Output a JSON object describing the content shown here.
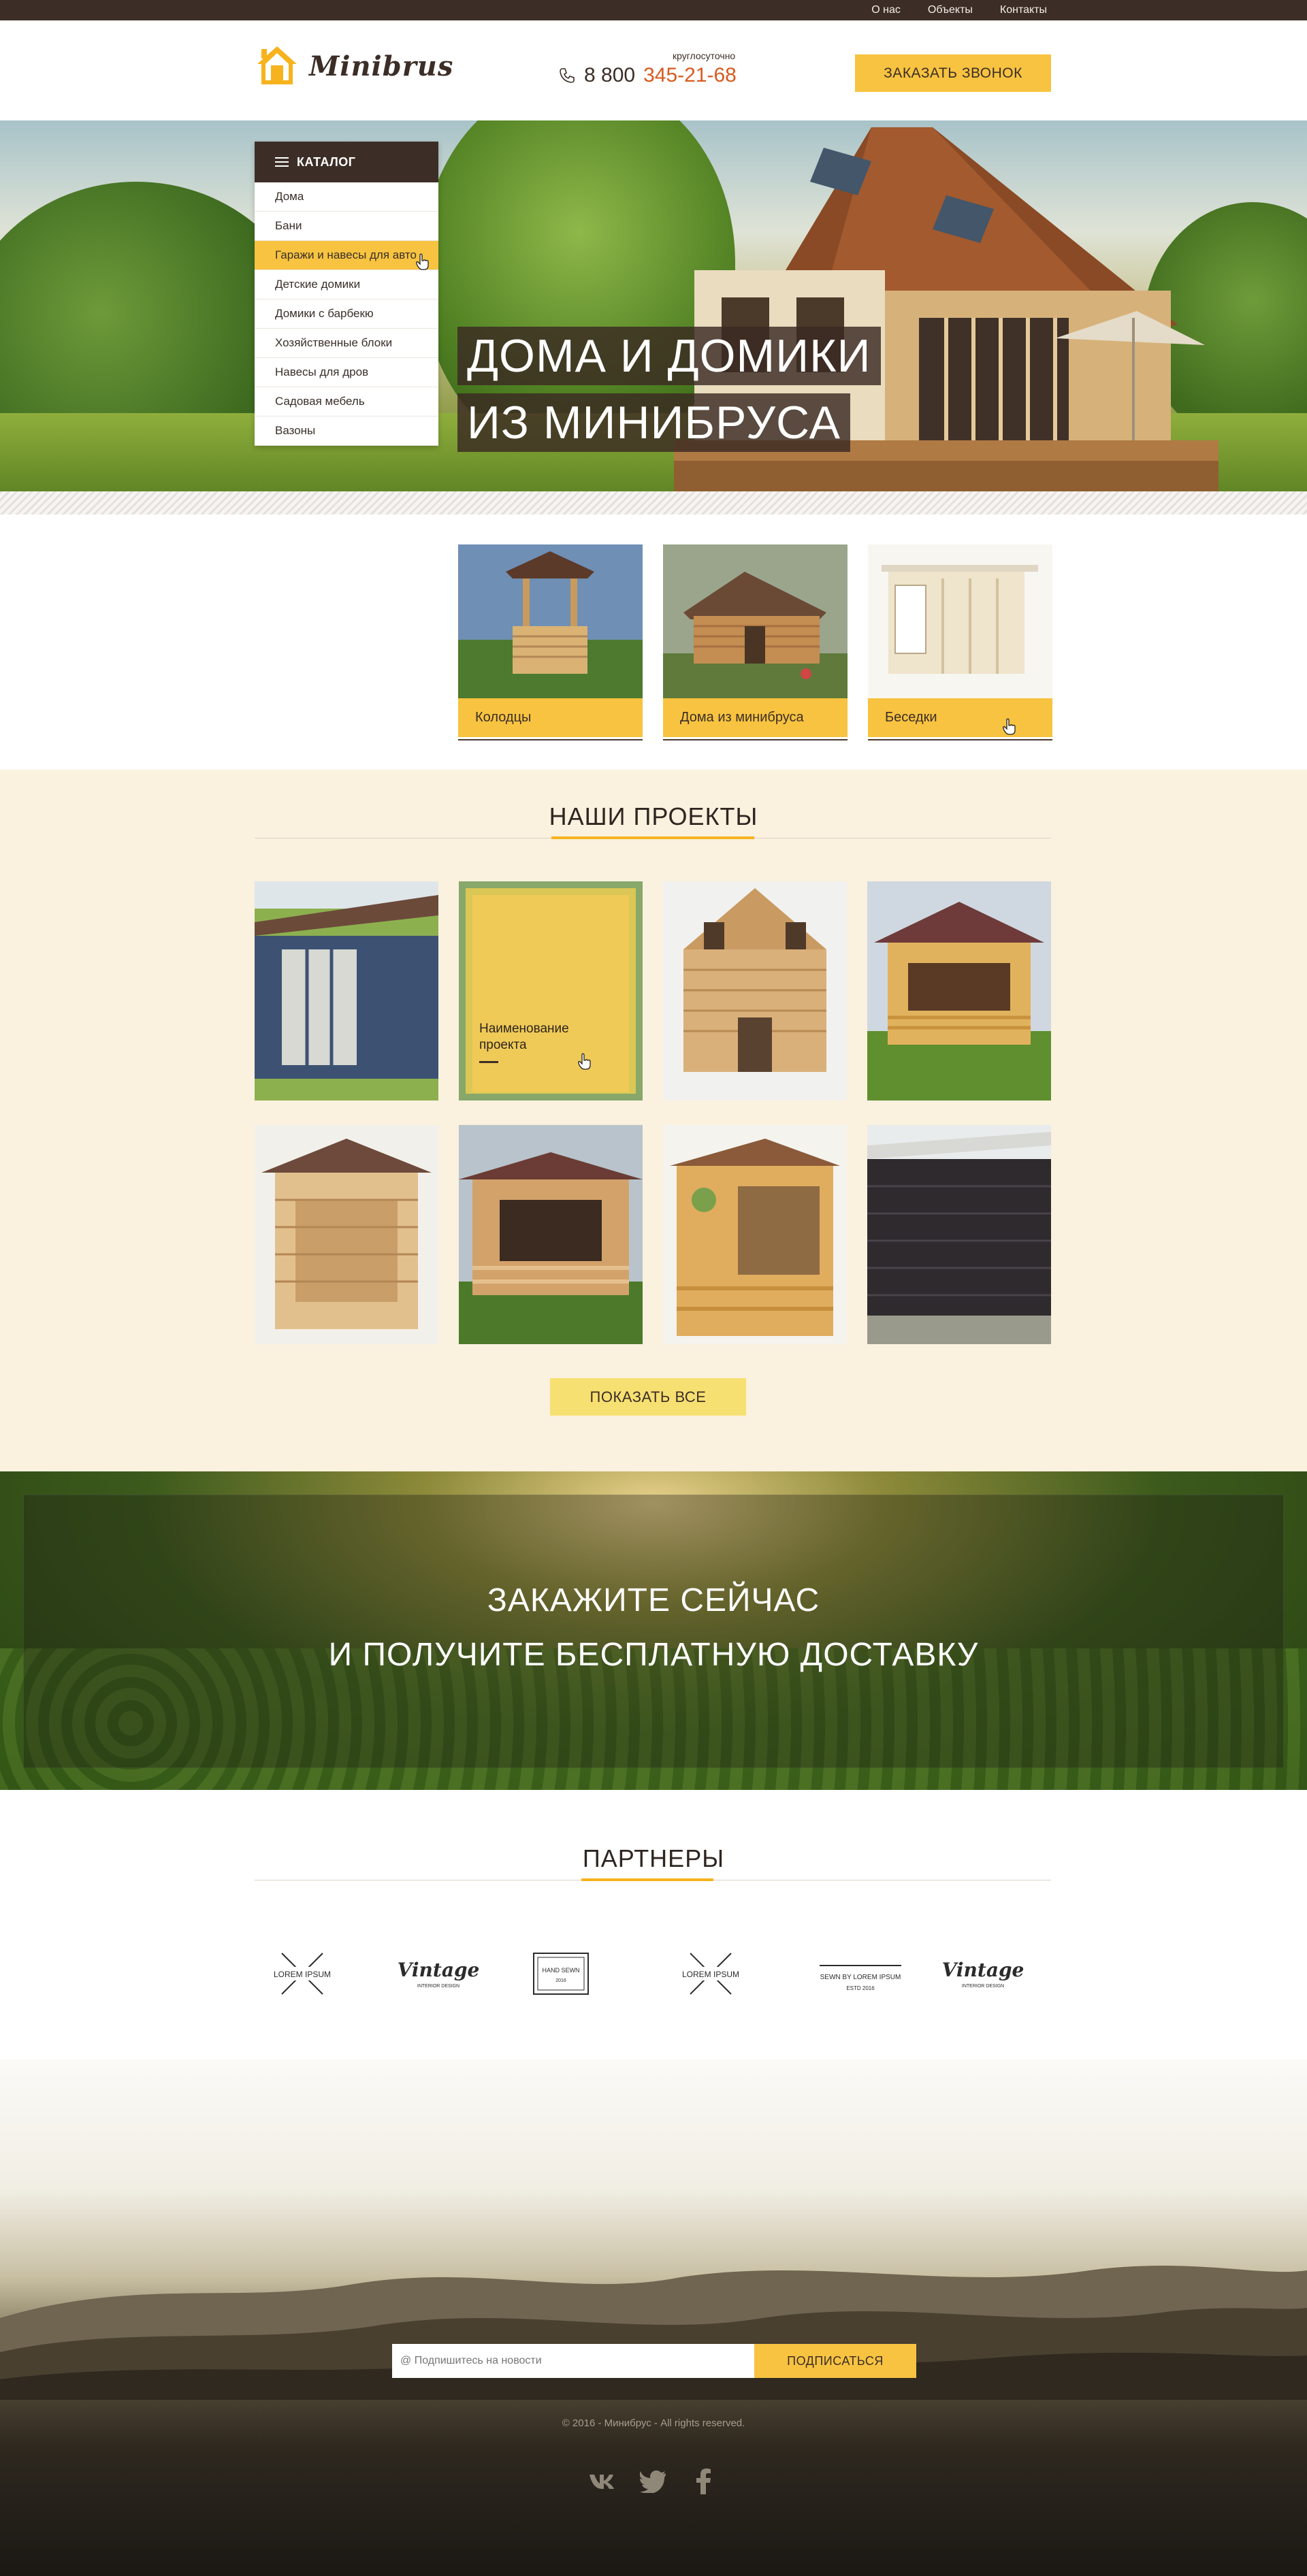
{
  "topbar": {
    "links": [
      "О нас",
      "Объекты",
      "Контакты"
    ]
  },
  "header": {
    "logo_text": "Minibrus",
    "phone_note": "круглосуточно",
    "phone_prefix": "8 800",
    "phone_main": "345-21-68",
    "callback_label": "ЗАКАЗАТЬ ЗВОНОК"
  },
  "catalog": {
    "title": "КАТАЛОГ",
    "items": [
      "Дома",
      "Бани",
      "Гаражи и навесы для авто",
      "Детские домики",
      "Домики с барбекю",
      "Хозяйственные блоки",
      "Навесы для дров",
      "Садовая мебель",
      "Вазоны"
    ],
    "active_index": 2
  },
  "hero": {
    "line1": "ДОМА И ДОМИКИ",
    "line2": "ИЗ МИНИБРУСА"
  },
  "categories": [
    "Колодцы",
    "Дома из минибруса",
    "Беседки"
  ],
  "projects": {
    "title": "НАШИ ПРОЕКТЫ",
    "hover_name": "Наименование проекта",
    "show_all_label": "ПОКАЗАТЬ ВСЕ"
  },
  "promo": {
    "line1": "ЗАКАЖИТЕ СЕЙЧАС",
    "line2": "И ПОЛУЧИТЕ БЕСПЛАТНУЮ ДОСТАВКУ"
  },
  "partners": {
    "title": "ПАРТНЕРЫ",
    "logos": [
      "LOREM IPSUM",
      "Vintage",
      "HAND SEWN",
      "LOREM IPSUM",
      "SEWN BY LOREM IPSUM",
      "Vintage"
    ],
    "vintage_sub": "INTERIOR DESIGN",
    "hand_sewn_sub": "2016",
    "sewn_by_est": "ESTD 2016"
  },
  "footer": {
    "subscribe_placeholder": "@ Подпишитесь на новости",
    "subscribe_label": "ПОДПИСАТЬСЯ",
    "copyright": "© 2016 - Минибрус - All rights reserved.",
    "socials": [
      "vk",
      "twitter",
      "facebook"
    ]
  },
  "colors": {
    "accent": "#f7c340",
    "dark": "#3c2e27",
    "phone": "#d75a1e",
    "projects_bg": "#faf1df"
  }
}
